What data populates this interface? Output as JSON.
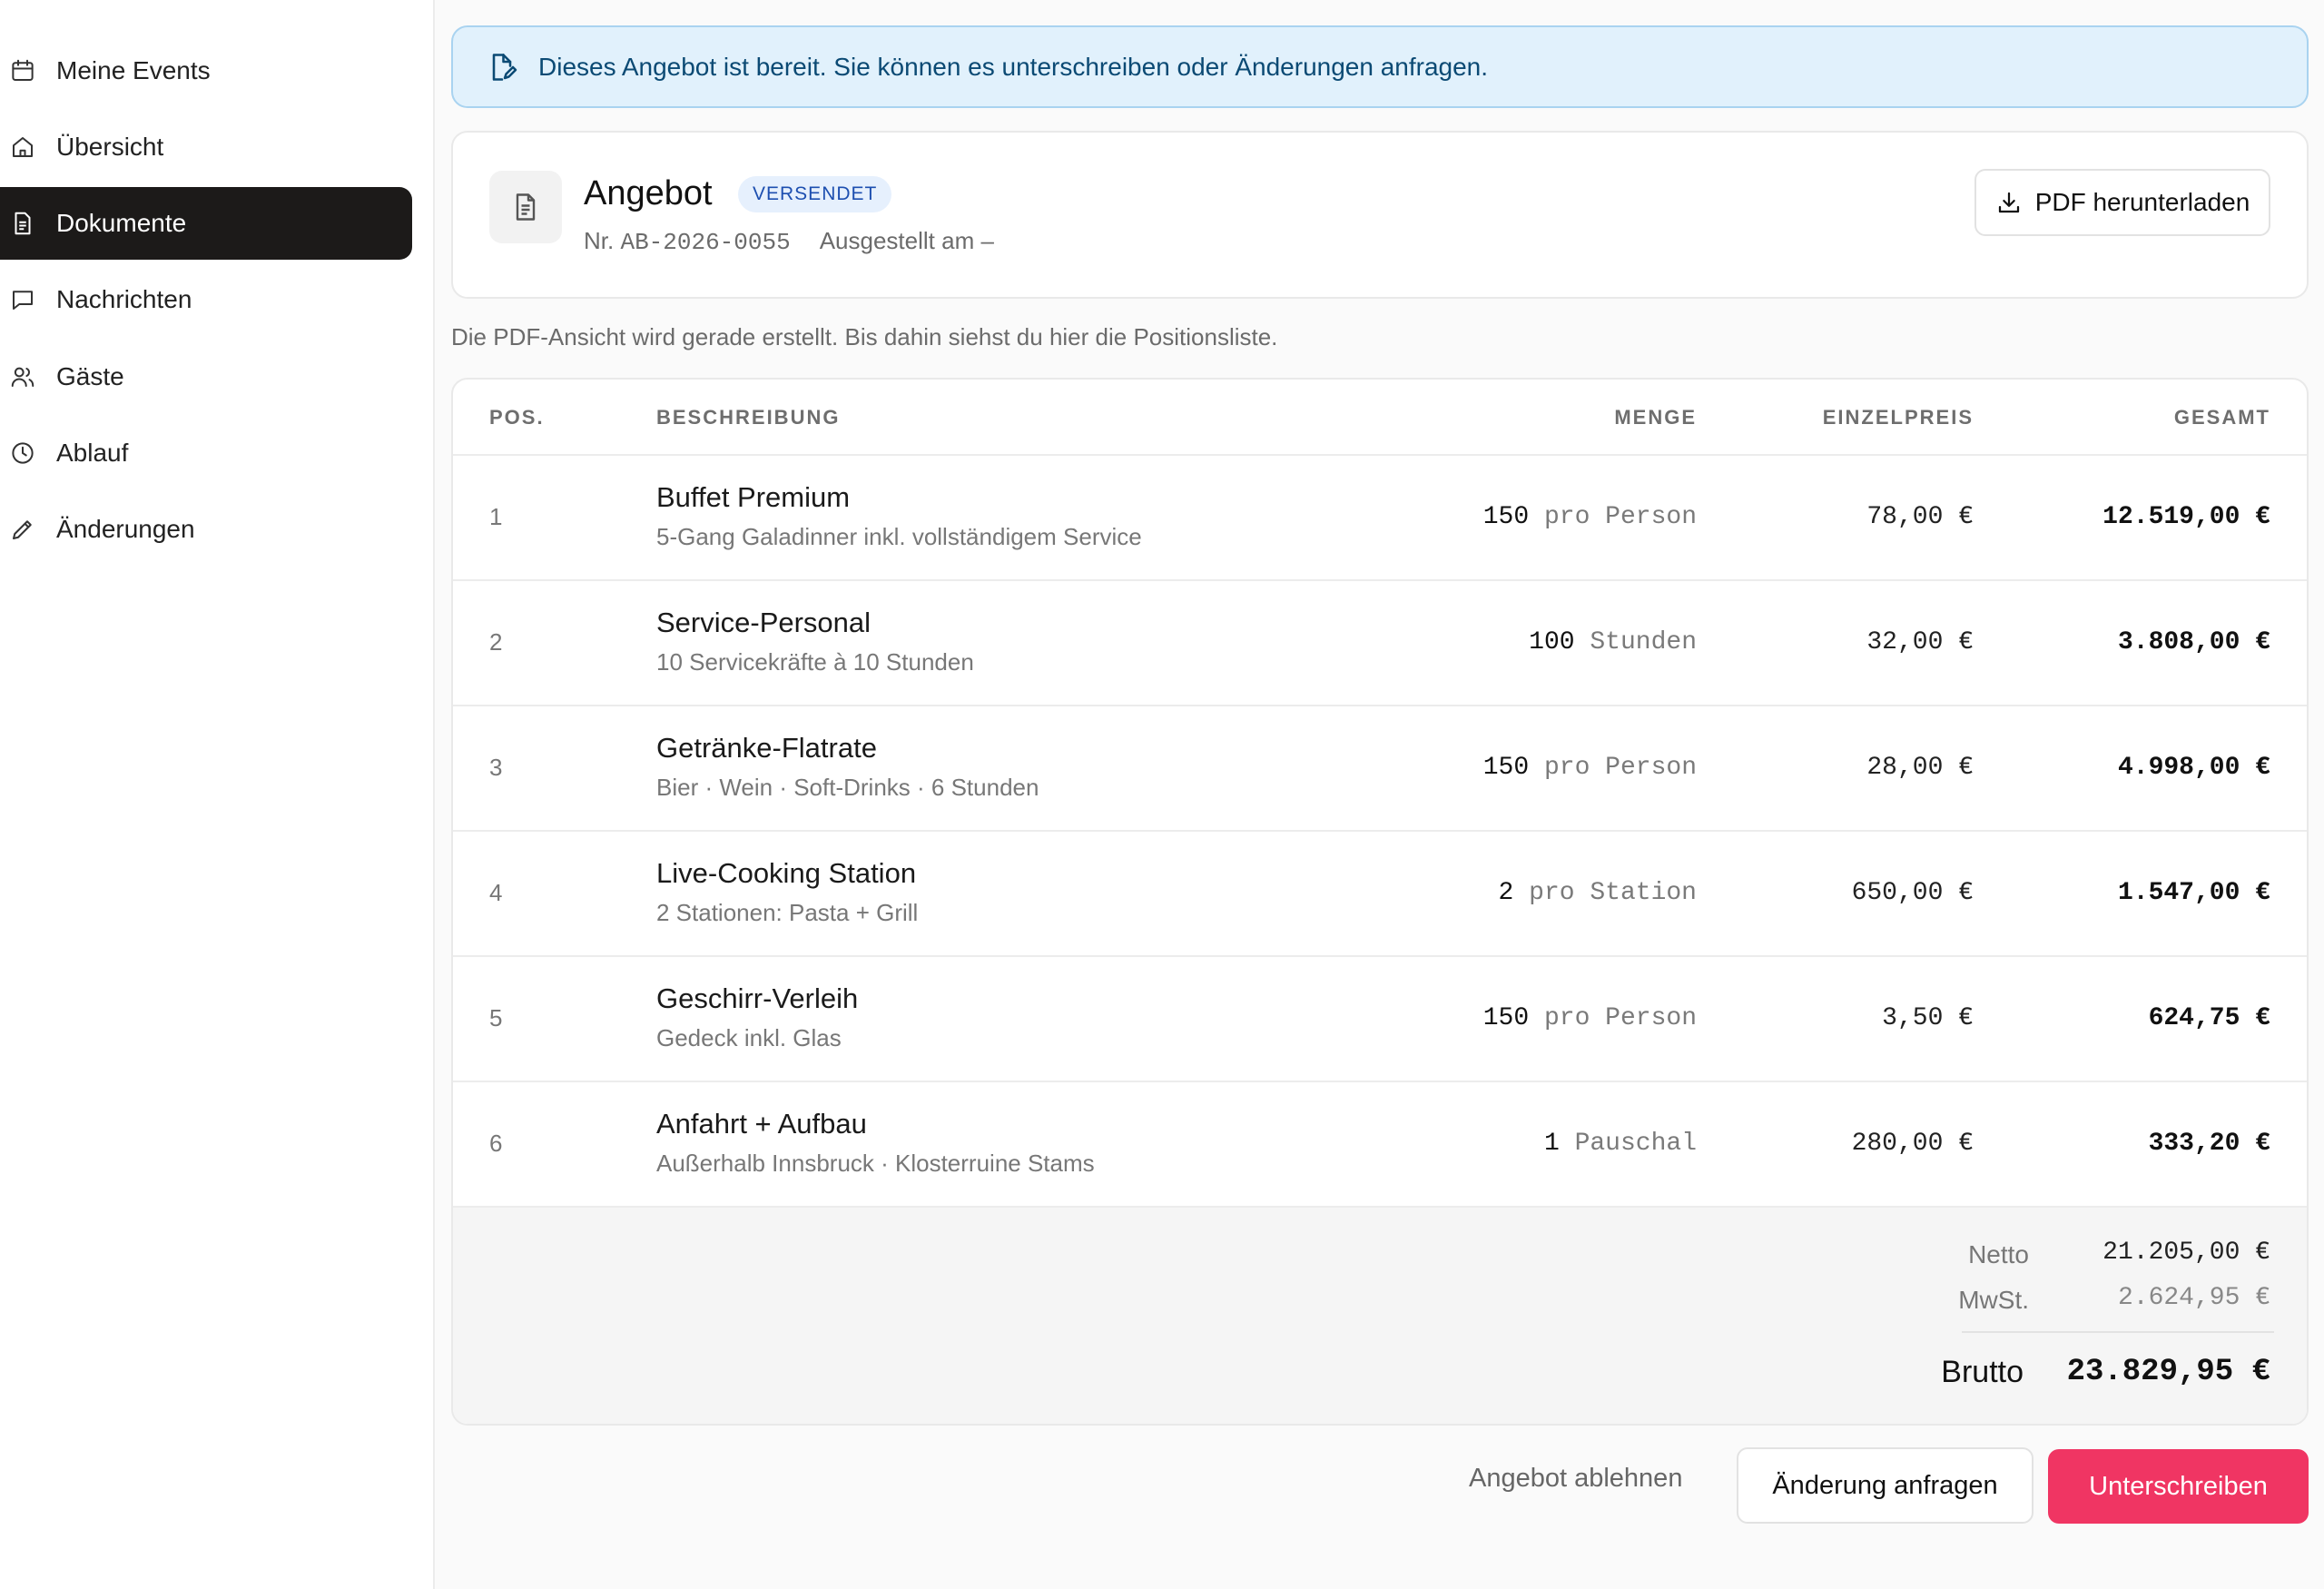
{
  "sidebar": {
    "items": [
      {
        "label": "Meine Events",
        "icon": "calendar-icon"
      },
      {
        "label": "Übersicht",
        "icon": "home-icon"
      },
      {
        "label": "Dokumente",
        "icon": "document-icon",
        "active": true
      },
      {
        "label": "Nachrichten",
        "icon": "chat-icon"
      },
      {
        "label": "Gäste",
        "icon": "users-icon"
      },
      {
        "label": "Ablauf",
        "icon": "clock-icon"
      },
      {
        "label": "Änderungen",
        "icon": "pencil-icon"
      }
    ]
  },
  "alert": {
    "text": "Dieses Angebot ist bereit. Sie können es unterschreiben oder Änderungen anfragen.",
    "icon": "edit-document-icon"
  },
  "document": {
    "title": "Angebot",
    "status": "VERSENDET",
    "number_prefix": "Nr.",
    "number": "AB-2026-0055",
    "issued": "Ausgestellt am –",
    "download_label": "PDF herunterladen"
  },
  "info_text": "Die PDF-Ansicht wird gerade erstellt. Bis dahin siehst du hier die Positionsliste.",
  "table": {
    "headers": {
      "pos": "POS.",
      "desc": "BESCHREIBUNG",
      "qty": "MENGE",
      "price": "EINZELPREIS",
      "total": "GESAMT"
    },
    "rows": [
      {
        "pos": "1",
        "title": "Buffet Premium",
        "sub": "5-Gang Galadinner inkl. vollständigem Service",
        "qty": "150",
        "unit": "pro Person",
        "price": "78,00 €",
        "total": "12.519,00 €"
      },
      {
        "pos": "2",
        "title": "Service-Personal",
        "sub": "10 Servicekräfte à 10 Stunden",
        "qty": "100",
        "unit": "Stunden",
        "price": "32,00 €",
        "total": "3.808,00 €"
      },
      {
        "pos": "3",
        "title": "Getränke-Flatrate",
        "sub": "Bier · Wein · Soft-Drinks · 6 Stunden",
        "qty": "150",
        "unit": "pro Person",
        "price": "28,00 €",
        "total": "4.998,00 €"
      },
      {
        "pos": "4",
        "title": "Live-Cooking Station",
        "sub": "2 Stationen: Pasta + Grill",
        "qty": "2",
        "unit": "pro Station",
        "price": "650,00 €",
        "total": "1.547,00 €"
      },
      {
        "pos": "5",
        "title": "Geschirr-Verleih",
        "sub": "Gedeck inkl. Glas",
        "qty": "150",
        "unit": "pro Person",
        "price": "3,50 €",
        "total": "624,75 €"
      },
      {
        "pos": "6",
        "title": "Anfahrt + Aufbau",
        "sub": "Außerhalb Innsbruck · Klosterruine Stams",
        "qty": "1",
        "unit": "Pauschal",
        "price": "280,00 €",
        "total": "333,20 €"
      }
    ]
  },
  "totals": {
    "netto_label": "Netto",
    "netto": "21.205,00 €",
    "mwst_label": "MwSt.",
    "mwst": "2.624,95 €",
    "brutto_label": "Brutto",
    "brutto": "23.829,95 €"
  },
  "actions": {
    "reject": "Angebot ablehnen",
    "request_change": "Änderung anfragen",
    "sign": "Unterschreiben"
  },
  "colors": {
    "accent": "#f03563",
    "active_nav": "#1c1a19",
    "alert_bg": "#e1f1fc",
    "badge_text": "#1d4fb0"
  }
}
